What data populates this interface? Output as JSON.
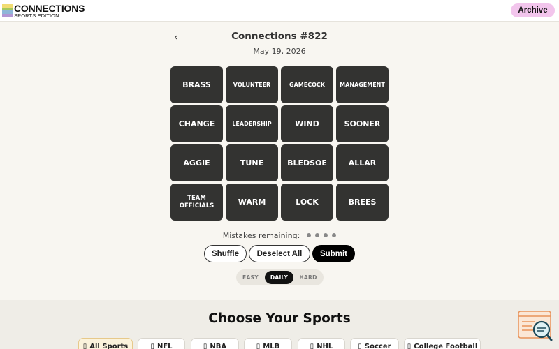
{
  "header": {
    "logo_title": "CONNECTIONS",
    "logo_subtitle": "SPORTS EDITION",
    "logo_colors": [
      "#f2dc72",
      "#a4c95d",
      "#8fb6d8",
      "#b296d4"
    ],
    "archive_label": "Archive"
  },
  "puzzle": {
    "back_icon": "chevron-left-icon",
    "back_glyph": "‹",
    "title": "Connections #822",
    "date": "May 19, 2026"
  },
  "tiles": [
    "BRASS",
    "VOLUNTEER",
    "GAMECOCK",
    "MANAGEMENT",
    "CHANGE",
    "LEADERSHIP",
    "WIND",
    "SOONER",
    "AGGIE",
    "TUNE",
    "BLEDSOE",
    "ALLAR",
    "TEAM OFFICIALS",
    "WARM",
    "LOCK",
    "BREES"
  ],
  "mistakes": {
    "label": "Mistakes remaining:",
    "remaining": 4
  },
  "actions": {
    "shuffle": "Shuffle",
    "deselect_all": "Deselect All",
    "submit": "Submit"
  },
  "difficulty": {
    "options": [
      "EASY",
      "DAILY",
      "HARD"
    ],
    "selected": "DAILY"
  },
  "sports": {
    "title": "Choose Your Sports",
    "icon_glyph": "▯",
    "chips": [
      "All Sports",
      "NFL",
      "NBA",
      "MLB",
      "NHL",
      "Soccer",
      "College Football"
    ],
    "selected": "All Sports"
  },
  "colors": {
    "tile_bg": "#333331",
    "archive_bg": "#f2c5ec",
    "page_bg": "#f8f6f1"
  }
}
